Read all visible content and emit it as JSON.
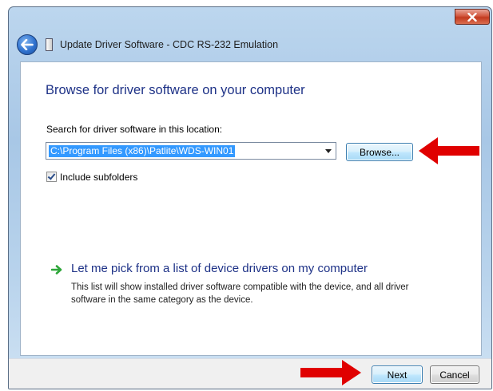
{
  "window": {
    "title": "Update Driver Software - CDC RS-232 Emulation"
  },
  "content": {
    "heading": "Browse for driver software on your computer",
    "search_label": "Search for driver software in this location:",
    "path_value": "C:\\Program Files (x86)\\Patlite\\WDS-WIN01",
    "browse_label": "Browse...",
    "include_subfolders_label": "Include subfolders",
    "include_subfolders_checked": true,
    "pick_link": "Let me pick from a list of device drivers on my computer",
    "pick_description": "This list will show installed driver software compatible with the device, and all driver software in the same category as the device."
  },
  "footer": {
    "next_label": "Next",
    "cancel_label": "Cancel"
  },
  "icons": {
    "close": "close-icon",
    "back": "back-arrow-icon",
    "title": "device-icon",
    "pick": "green-arrow-icon",
    "annotation": "red-arrow-icon"
  },
  "colors": {
    "heading": "#1e3287",
    "selection": "#3399ff",
    "close_button": "#c23a1f",
    "annotation_arrow": "#e00000",
    "pick_arrow": "#2ea63a"
  }
}
